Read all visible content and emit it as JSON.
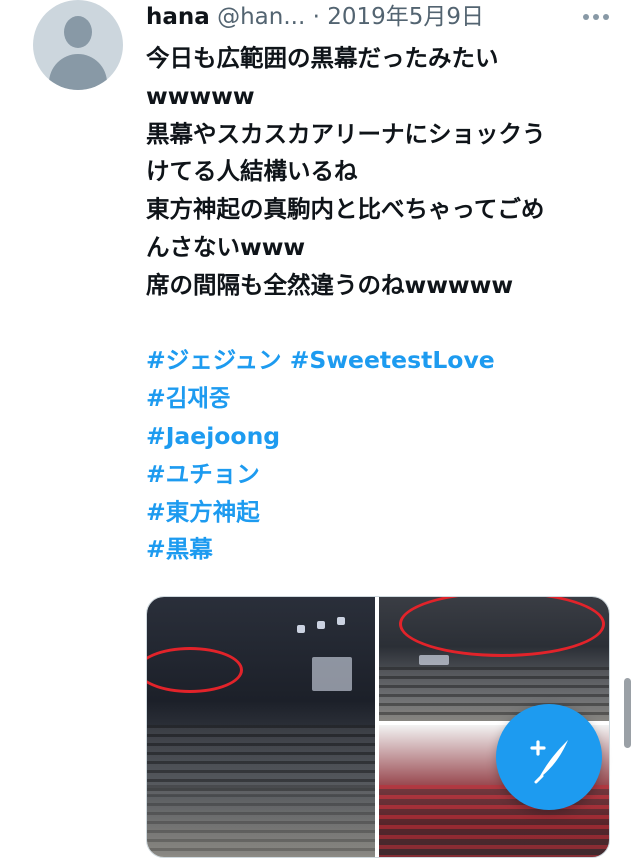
{
  "author": {
    "name": "hana",
    "handle": "@han...",
    "separator": "·",
    "date": "2019年5月9日"
  },
  "tweet": {
    "lines": [
      "今日も広範囲の黒幕だったみたい",
      "wwwww",
      "黒幕やスカスカアリーナにショックう",
      "けてる人結構いるね",
      "東方神起の真駒内と比べちゃってごめ",
      "んさないwww",
      "席の間隔も全然違うのねwwwww"
    ],
    "hashtags_line1": [
      "#ジェジュン",
      "#SweetestLove"
    ],
    "hashtags": [
      "#김재중",
      "#Jaejoong",
      "#ユチョン",
      "#東方神起",
      "#黒幕"
    ]
  },
  "icons": {
    "avatar": "default-avatar-icon",
    "more": "more-options-icon",
    "compose": "compose-tweet-icon"
  },
  "colors": {
    "link": "#1d9bf0",
    "text": "#0f1419",
    "muted": "#536471",
    "fab": "#1d9bf0"
  }
}
